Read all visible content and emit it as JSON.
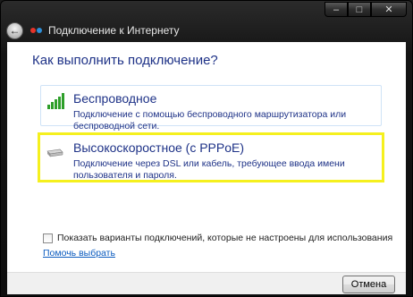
{
  "window": {
    "title": "Подключение к Интернету",
    "controls": {
      "minimize": "–",
      "maximize": "□",
      "close": "✕"
    }
  },
  "main": {
    "question": "Как выполнить подключение?",
    "options": [
      {
        "title": "Беспроводное",
        "description": "Подключение с помощью беспроводного маршрутизатора или беспроводной сети.",
        "icon": "wireless-signal-icon"
      },
      {
        "title": "Высокоскоростное (с PPPoE)",
        "description": "Подключение через DSL или кабель, требующее ввода имени пользователя и пароля.",
        "icon": "dsl-modem-icon",
        "highlight_color": "#f5f01e"
      }
    ],
    "show_unconfigured_label": "Показать варианты подключений, которые не настроены для использования",
    "help_link": "Помочь выбрать"
  },
  "footer": {
    "cancel_label": "Отмена"
  }
}
